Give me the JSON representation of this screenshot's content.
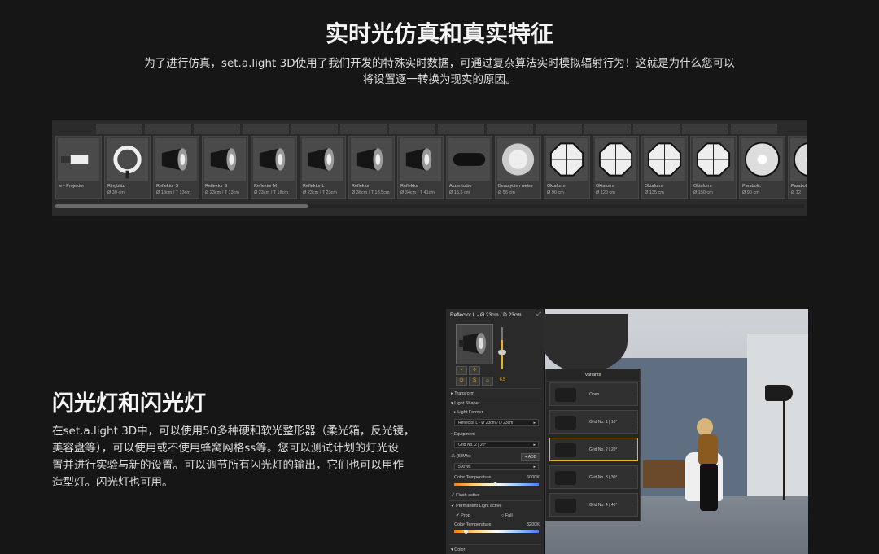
{
  "section_sim": {
    "title": "实时光仿真和真实特征",
    "desc_line1": "为了进行仿真，set.a.light 3D使用了我们开发的特殊实时数据，可通过复杂算法实时模拟辐射行为！这就是为什么您可以",
    "desc_line2": "将设置逐一转换为现实的原因。"
  },
  "library": {
    "items": [
      {
        "name": "ie - Projektor",
        "size": ""
      },
      {
        "name": "Ringblitz",
        "size": "Ø 30 cm"
      },
      {
        "name": "Reflektor S",
        "size": "Ø 18cm / T 13cm"
      },
      {
        "name": "Reflektor S",
        "size": "Ø 23cm / T 13cm"
      },
      {
        "name": "Reflektor M",
        "size": "Ø 23cm / T 18cm"
      },
      {
        "name": "Reflektor L",
        "size": "Ø 23cm / T 23cm"
      },
      {
        "name": "Reflektor",
        "size": "Ø 36cm / T 18.5cm"
      },
      {
        "name": "Reflektor",
        "size": "Ø 34cm / T 41cm"
      },
      {
        "name": "Akzentutbe",
        "size": "Ø 16.5 cm"
      },
      {
        "name": "Beautydish weiss",
        "size": "Ø 56 cm"
      },
      {
        "name": "Oktaform",
        "size": "Ø 90 cm"
      },
      {
        "name": "Oktaform",
        "size": "Ø 120 cm"
      },
      {
        "name": "Oktaform",
        "size": "Ø 135 cm"
      },
      {
        "name": "Oktaform",
        "size": "Ø 150 cm"
      },
      {
        "name": "Parabolic",
        "size": "Ø 90 cm"
      },
      {
        "name": "Parabolic",
        "size": "Ø 12"
      }
    ]
  },
  "section_flash": {
    "title": "闪光灯和闪光灯",
    "desc_lines": [
      "在set.a.light 3D中，可以使用50多种硬和软光整形器（柔光箱，反光镜，",
      "美容盘等），可以使用或不使用蜂窝网格ss等。您可以测试计划的灯光设",
      "置并进行实验与新的设置。可以调节所有闪光灯的输出，它们也可以用作",
      "造型灯。闪光灯也可用。"
    ]
  },
  "app": {
    "panel_title": "Reflector L - Ø 23cm / D 23cm",
    "power_value": "6.5",
    "transform": "Transform",
    "light_shaper": "Light Shaper",
    "light_former": "Light Former",
    "light_former_value": "Reflector L - Ø 23cm / D 23cm",
    "equipment": "Equipment",
    "equipment_value": "Grid No. 2 | 20°",
    "power_label": "(58Ws)",
    "add_label": "ADD",
    "power_select": "500Ws",
    "color_temp_label": "Color Temperature",
    "color_temp_value": "6000K",
    "flash_active": "Flash active",
    "permanent_light": "Permanent Light active",
    "prop": "Prop",
    "full": "Full",
    "color_temp2_label": "Color Temperature",
    "color_temp2_value": "3200K",
    "color": "Color",
    "variants_title": "Variants",
    "variants": [
      "Open",
      "Grid No. 1 | 10°",
      "Grid No. 2 | 20°",
      "Grid No. 3 | 30°",
      "Grid No. 4 | 40°"
    ],
    "active_variant": 2
  },
  "colors": {
    "accent": "#e6b422",
    "background": "#161616"
  }
}
